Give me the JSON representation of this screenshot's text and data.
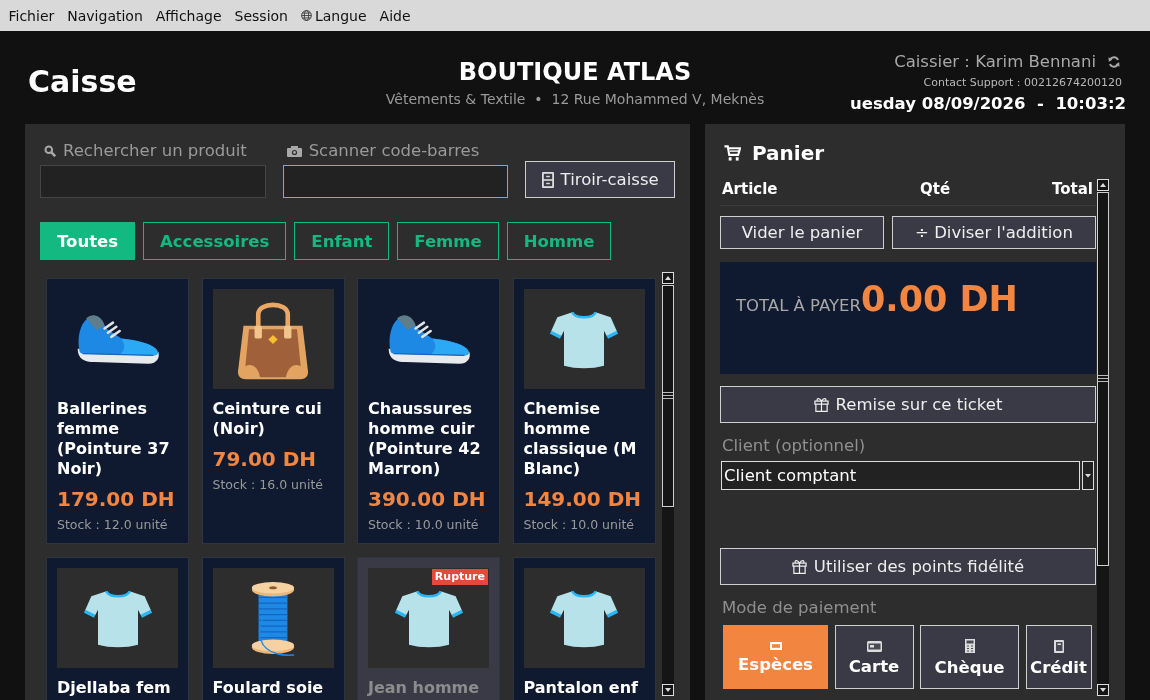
{
  "menu": [
    {
      "label": "Fichier",
      "kind": "plain"
    },
    {
      "label": "Navigation",
      "kind": "plain"
    },
    {
      "label": "Affichage",
      "kind": "plain"
    },
    {
      "label": "Session",
      "kind": "plain"
    },
    {
      "label": "Langue",
      "kind": "language"
    },
    {
      "label": "Aide",
      "kind": "plain"
    }
  ],
  "header": {
    "title": "Caisse",
    "store_name": "BOUTIQUE ATLAS",
    "store_info": "Vêtements & Textile  •  12 Rue Mohammed V, Meknès",
    "cashier": "Caissier : Karim Bennani",
    "support": "Contact Support : 00212674200120",
    "datetime": "uesday 08/09/2026  -  10:03:2"
  },
  "products_panel": {
    "search": {
      "label": "Rechercher un produit",
      "focused": false
    },
    "scanner": {
      "label": "Scanner code-barres",
      "focused": true
    },
    "drawer_button": "Tiroir-caisse",
    "categories": [
      {
        "label": "Toutes",
        "selected": true
      },
      {
        "label": "Accessoires",
        "selected": false
      },
      {
        "label": "Enfant",
        "selected": false
      },
      {
        "label": "Femme",
        "selected": false
      },
      {
        "label": "Homme",
        "selected": false
      }
    ],
    "products": [
      {
        "name": "Ballerines femme (Pointure 37 Noir)",
        "price": "179.00 DH",
        "stock": "Stock : 12.0 unité",
        "kind": "shoe",
        "out_of_stock": false
      },
      {
        "name": "Ceinture cui (Noir)",
        "price": "79.00 DH",
        "stock": "Stock : 16.0 unité",
        "kind": "bag",
        "out_of_stock": false
      },
      {
        "name": "Chaussures homme cuir (Pointure 42 Marron)",
        "price": "390.00 DH",
        "stock": "Stock : 10.0 unité",
        "kind": "shoe",
        "out_of_stock": false
      },
      {
        "name": "Chemise homme classique (M Blanc)",
        "price": "149.00 DH",
        "stock": "Stock : 10.0 unité",
        "kind": "shirt",
        "out_of_stock": false
      },
      {
        "name": "Djellaba fem",
        "kind": "shirt",
        "out_of_stock": false
      },
      {
        "name": "Foulard soie",
        "kind": "spool",
        "out_of_stock": false
      },
      {
        "name": "Jean homme",
        "kind": "shirt",
        "out_of_stock": true,
        "badge": "Rupture"
      },
      {
        "name": "Pantalon enf",
        "kind": "shirt",
        "out_of_stock": false
      }
    ]
  },
  "cart": {
    "title": "Panier",
    "columns": [
      "Article",
      "Qté",
      "Total"
    ],
    "clear_button": "Vider le panier",
    "split_button": "÷ Diviser l'addition",
    "total_label": "TOTAL À PAYER",
    "total": "0.00 DH",
    "discount_button": "Remise sur ce ticket",
    "client": {
      "label": "Client (optionnel)",
      "value": "Client comptant"
    },
    "loyalty_button": "Utiliser des points fidélité",
    "payment": {
      "label": "Mode de paiement",
      "methods": [
        {
          "label": "Espèces",
          "kind": "cash",
          "selected": true
        },
        {
          "label": "Carte",
          "kind": "card",
          "selected": false
        },
        {
          "label": "Chèque",
          "kind": "cheque",
          "selected": false
        },
        {
          "label": "Crédit",
          "kind": "credit",
          "selected": false
        }
      ]
    }
  }
}
